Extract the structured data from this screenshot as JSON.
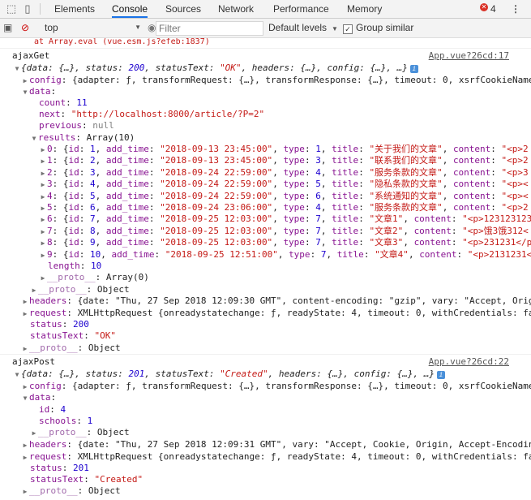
{
  "devtools": {
    "tabs": [
      "Elements",
      "Console",
      "Sources",
      "Network",
      "Performance",
      "Memory"
    ],
    "active_tab": "Console",
    "error_count": "4",
    "error_badge": "✕",
    "more_label": "⋮",
    "accent_color": "#1a73e8",
    "error_color": "#d93025"
  },
  "toolbar": {
    "context": "top",
    "filter_placeholder": "Filter",
    "levels_label": "Default levels",
    "group_similar_label": "Group similar"
  },
  "console": {
    "error_tail": "at Array.eval (vue.esm.js?efeb:1837)",
    "get": {
      "label": "ajaxGet",
      "source": "App.vue?26cd:17",
      "summary": {
        "data": "{…}",
        "status": "200",
        "statusText": "\"OK\"",
        "headers": "{…}",
        "config": "{…}",
        "ellipsis": "…}"
      },
      "config_preview": "{adapter: ƒ, transformRequest: {…}, transformResponse: {…}, timeout: 0, xsrfCookieName",
      "data": {
        "count": "11",
        "next": "\"http://localhost:8000/article/?P=2\"",
        "previous": "null",
        "results_preview": "Array(10)",
        "results": [
          {
            "idx": "0",
            "id": "1",
            "add_time": "\"2018-09-13 23:45:00\"",
            "type": "1",
            "title": "\"关于我们的文章\"",
            "content": "\"<p>2"
          },
          {
            "idx": "1",
            "id": "2",
            "add_time": "\"2018-09-13 23:45:00\"",
            "type": "3",
            "title": "\"联系我们的文章\"",
            "content": "\"<p>2"
          },
          {
            "idx": "2",
            "id": "3",
            "add_time": "\"2018-09-24 22:59:00\"",
            "type": "4",
            "title": "\"服务条款的文章\"",
            "content": "\"<p>3"
          },
          {
            "idx": "3",
            "id": "4",
            "add_time": "\"2018-09-24 22:59:00\"",
            "type": "5",
            "title": "\"隐私条款的文章\"",
            "content": "\"<p><"
          },
          {
            "idx": "4",
            "id": "5",
            "add_time": "\"2018-09-24 22:59:00\"",
            "type": "6",
            "title": "\"系统通知的文章\"",
            "content": "\"<p><"
          },
          {
            "idx": "5",
            "id": "6",
            "add_time": "\"2018-09-24 23:06:00\"",
            "type": "4",
            "title": "\"服务条款的文章\"",
            "content": "\"<p>2"
          },
          {
            "idx": "6",
            "id": "7",
            "add_time": "\"2018-09-25 12:03:00\"",
            "type": "7",
            "title": "\"文章1\"",
            "content": "\"<p>123123123"
          },
          {
            "idx": "7",
            "id": "8",
            "add_time": "\"2018-09-25 12:03:00\"",
            "type": "7",
            "title": "\"文章2\"",
            "content": "\"<p>饿3饿312<"
          },
          {
            "idx": "8",
            "id": "9",
            "add_time": "\"2018-09-25 12:03:00\"",
            "type": "7",
            "title": "\"文章3\"",
            "content": "\"<p>231231</p"
          },
          {
            "idx": "9",
            "id": "10",
            "add_time": "\"2018-09-25 12:51:00\"",
            "type": "7",
            "title": "\"文章4\"",
            "content": "\"<p>2131231<"
          }
        ],
        "length": "10",
        "results_proto": "Array(0)"
      },
      "data_proto": "Object",
      "headers_preview": "{date: \"Thu, 27 Sep 2018 12:09:30 GMT\", content-encoding: \"gzip\", vary: \"Accept, Orig",
      "request_preview": "XMLHttpRequest {onreadystatechange: ƒ, readyState: 4, timeout: 0, withCredentials: fa",
      "status": "200",
      "statusText": "\"OK\"",
      "proto": "Object"
    },
    "post": {
      "label": "ajaxPost",
      "source": "App.vue?26cd:22",
      "summary": {
        "data": "{…}",
        "status": "201",
        "statusText": "\"Created\"",
        "headers": "{…}",
        "config": "{…}",
        "ellipsis": "…}"
      },
      "config_preview": "{adapter: ƒ, transformRequest: {…}, transformResponse: {…}, timeout: 0, xsrfCookieName",
      "data": {
        "id": "4",
        "schools": "1",
        "proto": "Object"
      },
      "headers_preview": "{date: \"Thu, 27 Sep 2018 12:09:31 GMT\", vary: \"Accept, Cookie, Origin, Accept-Encodin",
      "request_preview": "XMLHttpRequest {onreadystatechange: ƒ, readyState: 4, timeout: 0, withCredentials: fa",
      "status": "201",
      "statusText": "\"Created\"",
      "proto": "Object"
    }
  }
}
